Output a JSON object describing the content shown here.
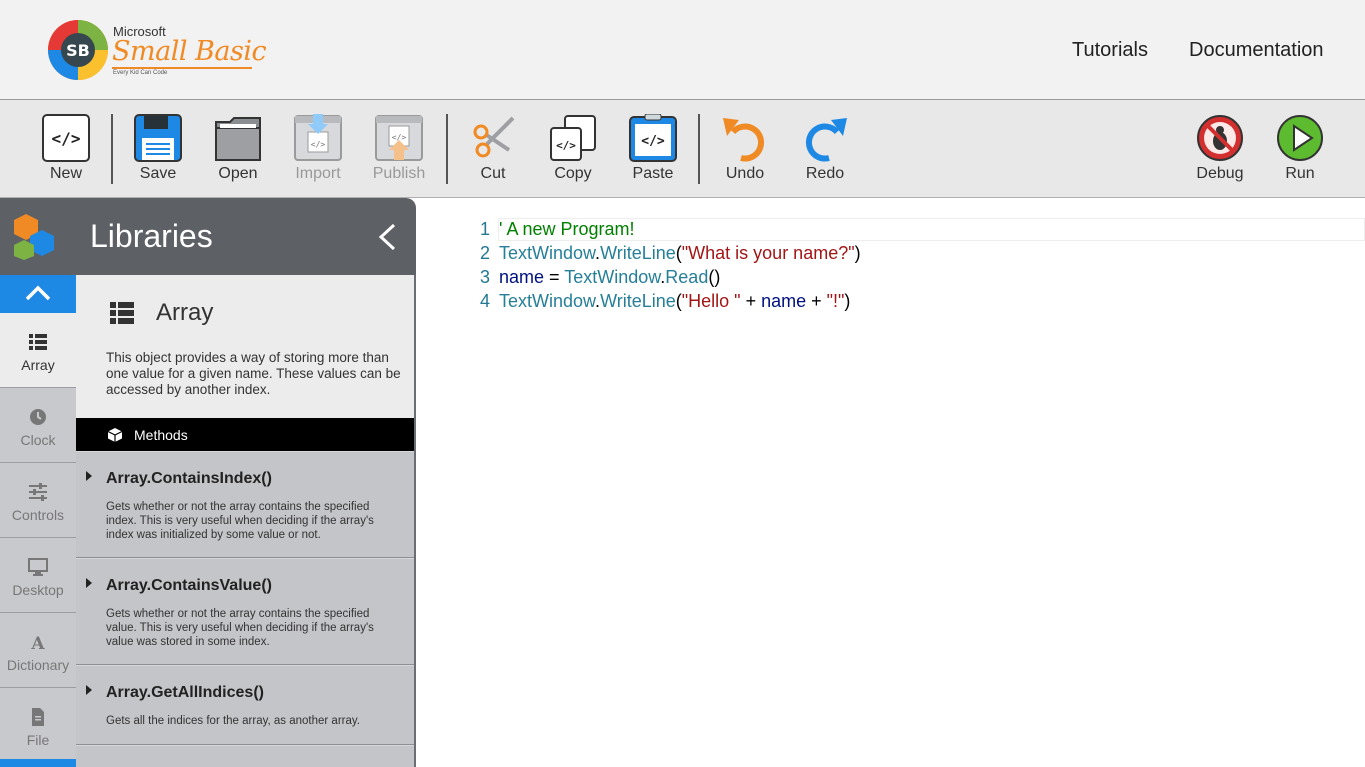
{
  "header": {
    "logo": {
      "ms": "Microsoft",
      "sb": "Small Basic",
      "tag": "Every Kid Can Code"
    },
    "nav": [
      "Tutorials",
      "Documentation"
    ]
  },
  "toolbar": {
    "new": "New",
    "save": "Save",
    "open": "Open",
    "import": "Import",
    "publish": "Publish",
    "cut": "Cut",
    "copy": "Copy",
    "paste": "Paste",
    "undo": "Undo",
    "redo": "Redo",
    "debug": "Debug",
    "run": "Run"
  },
  "libraries": {
    "title": "Libraries",
    "tabs": [
      "Array",
      "Clock",
      "Controls",
      "Desktop",
      "Dictionary",
      "File"
    ],
    "active_tab": "Array",
    "object": {
      "name": "Array",
      "description": "This object provides a way of storing more than one value for a given name. These values can be accessed by another index."
    },
    "methods_label": "Methods",
    "methods": [
      {
        "name": "Array.ContainsIndex()",
        "desc": "Gets whether or not the array contains the specified index. This is very useful when deciding if the array's index was initialized by some value or not."
      },
      {
        "name": "Array.ContainsValue()",
        "desc": "Gets whether or not the array contains the specified value. This is very useful when deciding if the array's value was stored in some index."
      },
      {
        "name": "Array.GetAllIndices()",
        "desc": "Gets all the indices for the array, as another array."
      }
    ]
  },
  "editor": {
    "lines": [
      {
        "n": "1",
        "tokens": [
          {
            "t": "' A new Program!",
            "c": "comment"
          }
        ]
      },
      {
        "n": "2",
        "tokens": [
          {
            "t": "TextWindow",
            "c": "type"
          },
          {
            "t": ".",
            "c": "op"
          },
          {
            "t": "WriteLine",
            "c": "type"
          },
          {
            "t": "(",
            "c": "op"
          },
          {
            "t": "\"What is your name?\"",
            "c": "string"
          },
          {
            "t": ")",
            "c": "op"
          }
        ]
      },
      {
        "n": "3",
        "tokens": [
          {
            "t": "name",
            "c": "ident"
          },
          {
            "t": " = ",
            "c": "op"
          },
          {
            "t": "TextWindow",
            "c": "type"
          },
          {
            "t": ".",
            "c": "op"
          },
          {
            "t": "Read",
            "c": "type"
          },
          {
            "t": "()",
            "c": "op"
          }
        ]
      },
      {
        "n": "4",
        "tokens": [
          {
            "t": "TextWindow",
            "c": "type"
          },
          {
            "t": ".",
            "c": "op"
          },
          {
            "t": "WriteLine",
            "c": "type"
          },
          {
            "t": "(",
            "c": "op"
          },
          {
            "t": "\"Hello \"",
            "c": "string"
          },
          {
            "t": " + ",
            "c": "op"
          },
          {
            "t": "name",
            "c": "ident"
          },
          {
            "t": " + ",
            "c": "op"
          },
          {
            "t": "\"!\"",
            "c": "string"
          },
          {
            "t": ")",
            "c": "op"
          }
        ]
      }
    ]
  },
  "colors": {
    "accent": "#1e88e5",
    "run": "#5dbb2f",
    "debug": "#d32f2f",
    "undo": "#f08a24",
    "redo": "#1e88e5"
  }
}
